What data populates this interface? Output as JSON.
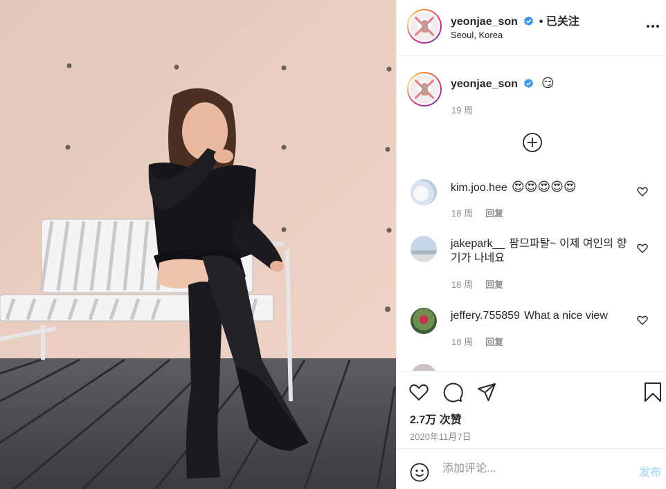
{
  "post": {
    "author": {
      "username": "yeonjae_son",
      "location": "Seoul, Korea",
      "follow_status": "• 已关注"
    },
    "caption": {
      "username": "yeonjae_son",
      "text": "😏",
      "time": "19 周"
    },
    "load_more_icon": "plus-circle-icon",
    "comments": [
      {
        "username": "kim.joo.hee",
        "text": "😍😍😍😍😍",
        "time": "18 周",
        "reply_label": "回复"
      },
      {
        "username": "jakepark__",
        "text": "팜므파탈~ 이제 여인의 향기가 나네요",
        "time": "18 周",
        "reply_label": "回复"
      },
      {
        "username": "jeffery.755859",
        "text": "What a nice view",
        "time": "18 周",
        "reply_label": "回复"
      }
    ],
    "likes": "2.7万 次赞",
    "date": "2020年11月7日",
    "composer": {
      "placeholder": "添加评论...",
      "post_label": "发布"
    }
  },
  "colors": {
    "verified": "#3897f0",
    "post_button_disabled": "#b2dffc",
    "secondary_text": "#8e8e8e"
  }
}
